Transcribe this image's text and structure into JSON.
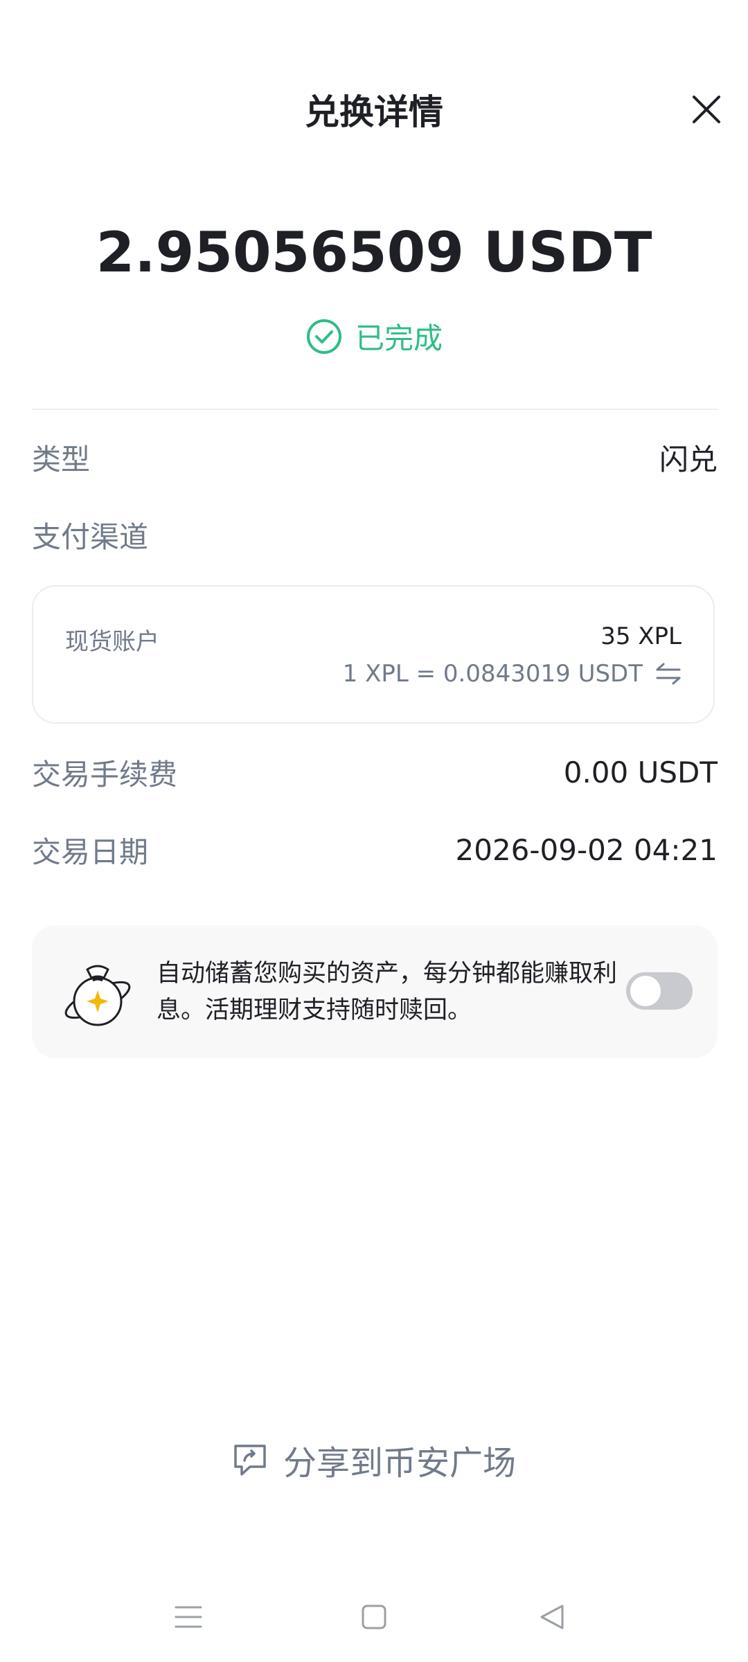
{
  "header": {
    "title": "兑换详情",
    "close_icon": "close-icon"
  },
  "summary": {
    "amount": "2.95056509 USDT",
    "status": "已完成",
    "status_color": "#2ebd85"
  },
  "details": {
    "type_label": "类型",
    "type_value": "闪兑",
    "channel_label": "支付渠道",
    "fee_label": "交易手续费",
    "fee_value": "0.00 USDT",
    "date_label": "交易日期",
    "date_value": "2026-09-02 04:21"
  },
  "payment": {
    "account": "现货账户",
    "amount": "35 XPL",
    "rate": "1 XPL = 0.0843019 USDT",
    "swap_icon": "swap-arrows-icon"
  },
  "earn": {
    "text": "自动储蓄您购买的资产，每分钟都能赚取利息。活期理财支持随时赎回。",
    "icon": "money-bag-icon",
    "toggle_on": false
  },
  "share": {
    "label": "分享到币安广场",
    "icon": "share-chat-icon"
  },
  "navbar": {
    "items": [
      "menu-icon",
      "home-square-icon",
      "back-triangle-icon"
    ]
  },
  "colors": {
    "accent_green": "#2ebd85",
    "text_primary": "#1e2026",
    "text_secondary": "#707a8a"
  }
}
